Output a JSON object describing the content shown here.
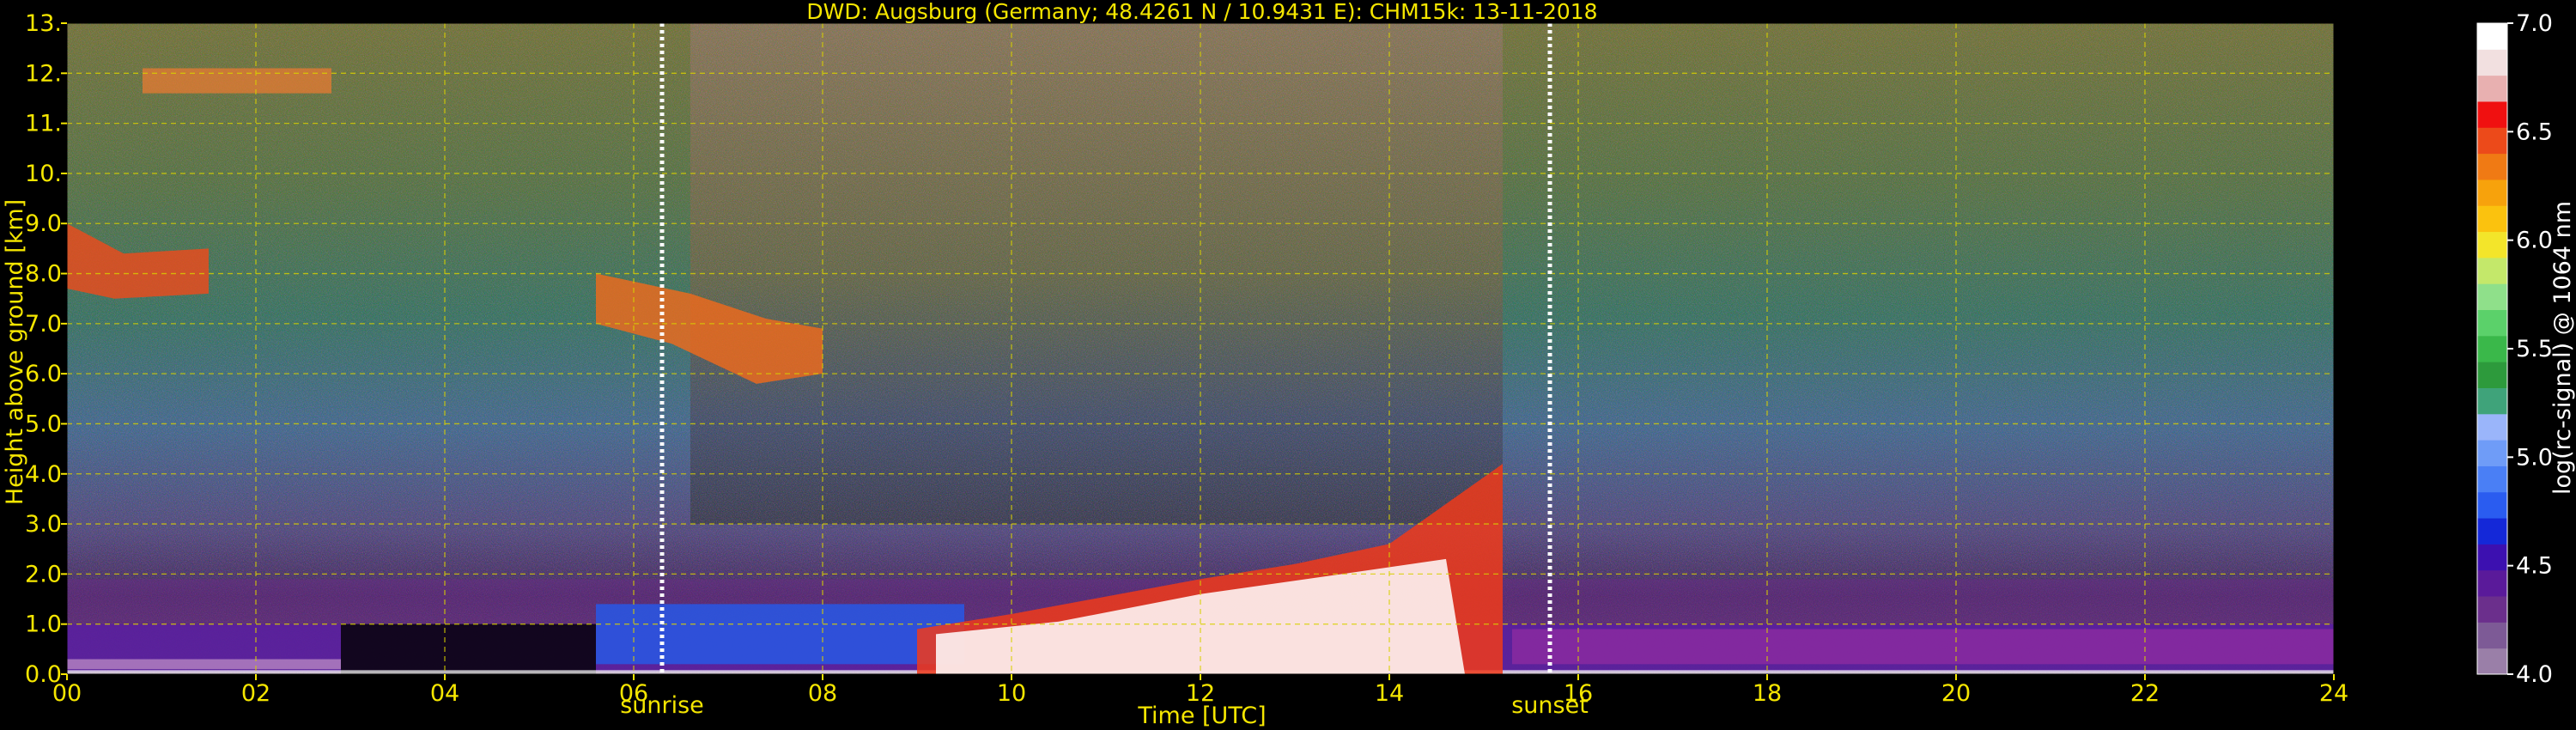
{
  "chart_data": {
    "type": "heatmap",
    "title": "DWD: Augsburg (Germany; 48.4261 N / 10.9431 E):    CHM15k: 13-11-2018",
    "xlabel": "Time [UTC]",
    "ylabel": "Height above ground [km]",
    "xlim": [
      0,
      24
    ],
    "ylim": [
      0,
      13
    ],
    "x_ticks": [
      "00",
      "02",
      "04",
      "06",
      "08",
      "10",
      "12",
      "14",
      "16",
      "18",
      "20",
      "22",
      "24"
    ],
    "y_ticks": [
      "0.0",
      "1.0",
      "2.0",
      "3.0",
      "4.0",
      "5.0",
      "6.0",
      "7.0",
      "8.0",
      "9.0",
      "10.",
      "11.",
      "12.",
      "13."
    ],
    "grid": true,
    "colorbar": {
      "label": "log(rc-signal) @ 1064 nm",
      "range": [
        4.0,
        7.0
      ],
      "ticks": [
        "4.0",
        "4.5",
        "5.0",
        "5.5",
        "6.0",
        "6.5",
        "7.0"
      ],
      "colors": [
        "#9a7fa8",
        "#7d5a96",
        "#6b2f8c",
        "#5a1a9a",
        "#3c10b0",
        "#1428d8",
        "#2a5cf0",
        "#4a7ff5",
        "#6f9cf7",
        "#9ab5fa",
        "#3fa37a",
        "#2d9a3c",
        "#3ab84a",
        "#5bd16a",
        "#8fe08a",
        "#c4e86a",
        "#f3e52a",
        "#fbc20e",
        "#f7a20c",
        "#f07a14",
        "#ec4a1a",
        "#f01010",
        "#e8b0b0",
        "#f2e0e0",
        "#ffffff"
      ]
    },
    "annotations": [
      {
        "x": 6.3,
        "label": "sunrise"
      },
      {
        "x": 15.7,
        "label": "sunset"
      }
    ],
    "features": [
      {
        "name": "boundary-layer-aerosol",
        "x": [
          0,
          24
        ],
        "y": [
          0,
          1.0
        ]
      },
      {
        "name": "cloud-layer-1",
        "x": [
          0,
          1.5
        ],
        "y": [
          7.5,
          9.0
        ]
      },
      {
        "name": "cloud-layer-2",
        "x": [
          5.6,
          8.0
        ],
        "y": [
          5.8,
          8.1
        ]
      },
      {
        "name": "cloud-top",
        "x": [
          0.8,
          2.8
        ],
        "y": [
          11.6,
          12.1
        ]
      },
      {
        "name": "low-cloud",
        "x": [
          9.0,
          15.3
        ],
        "y": [
          0,
          4.2
        ]
      }
    ]
  }
}
